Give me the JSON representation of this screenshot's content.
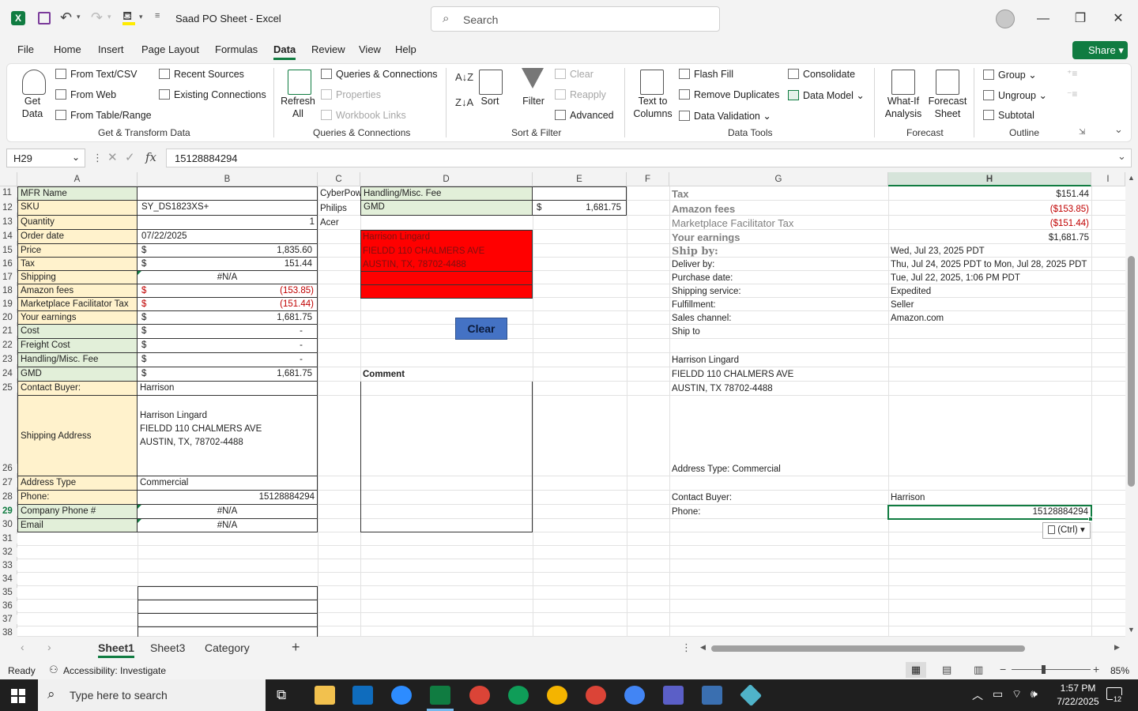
{
  "title_bar": {
    "doc_title": "Saad PO Sheet  -  Excel",
    "search_label": "Search"
  },
  "menu": [
    "File",
    "Home",
    "Insert",
    "Page Layout",
    "Formulas",
    "Data",
    "Review",
    "View",
    "Help"
  ],
  "menu_active": "Data",
  "share_label": "Share",
  "ribbon": {
    "get_data": "Get Data",
    "from_text": "From Text/CSV",
    "from_web": "From Web",
    "from_table": "From Table/Range",
    "recent_sources": "Recent Sources",
    "existing_connections": "Existing Connections",
    "group_get": "Get & Transform Data",
    "refresh_all": "Refresh All",
    "queries_connections": "Queries & Connections",
    "properties": "Properties",
    "workbook_links": "Workbook Links",
    "group_queries": "Queries & Connections",
    "sort": "Sort",
    "filter": "Filter",
    "clear": "Clear",
    "reapply": "Reapply",
    "advanced": "Advanced",
    "group_sort": "Sort & Filter",
    "text_to_columns": "Text to Columns",
    "flash_fill": "Flash Fill",
    "remove_duplicates": "Remove Duplicates",
    "data_validation": "Data Validation",
    "consolidate": "Consolidate",
    "data_model": "Data Model",
    "group_tools": "Data Tools",
    "what_if": "What-If Analysis",
    "forecast_sheet": "Forecast Sheet",
    "group_forecast": "Forecast",
    "group": "Group",
    "ungroup": "Ungroup",
    "subtotal": "Subtotal",
    "group_outline": "Outline"
  },
  "formula_bar": {
    "name_box": "H29",
    "fx": "fx",
    "value": "15128884294"
  },
  "columns": [
    "A",
    "B",
    "C",
    "D",
    "E",
    "F",
    "G",
    "H",
    "I"
  ],
  "rows": [
    "11",
    "12",
    "13",
    "14",
    "15",
    "16",
    "17",
    "18",
    "19",
    "20",
    "21",
    "22",
    "23",
    "24",
    "25",
    "26",
    "27",
    "28",
    "29",
    "30",
    "31",
    "32",
    "33",
    "34",
    "35",
    "36",
    "37",
    "38"
  ],
  "col_a": [
    "MFR Name",
    "SKU",
    "Quantity",
    "Order date",
    "Price",
    "Tax",
    "Shipping",
    "Amazon fees",
    "Marketplace Facilitator Tax",
    "Your earnings",
    "Cost",
    "Freight Cost",
    "Handling/Misc. Fee",
    "GMD",
    "Contact Buyer:",
    "Shipping Address",
    "Address Type",
    "Phone:",
    "Company Phone #",
    "Email"
  ],
  "col_b": {
    "sku": "SY_DS1823XS+",
    "qty": "1",
    "order_date": "07/22/2025",
    "dollar": "$",
    "price": "1,835.60",
    "tax": "151.44",
    "shipping": "#N/A",
    "amazon_fees": "(153.85)",
    "mft": "(151.44)",
    "earnings": "1,681.75",
    "dash": "-",
    "gmd": "1,681.75",
    "contact": "Harrison",
    "addr1": "Harrison Lingard",
    "addr2": "FIELDD 110 CHALMERS AVE",
    "addr3": "AUSTIN, TX, 78702-4488",
    "addr_type": "Commercial",
    "phone": "15128884294",
    "company_phone": "#N/A",
    "email": "#N/A"
  },
  "col_c": [
    "CyberPow",
    "Philips",
    "Acer"
  ],
  "col_d": {
    "handling": "Handling/Misc. Fee",
    "gmd": "GMD",
    "gmd_dollar": "$",
    "gmd_value": "1,681.75",
    "red1": "Harrison Lingard",
    "red2": "FIELDD 110 CHALMERS AVE",
    "red3": "AUSTIN, TX, 78702-4488",
    "clear_btn": "Clear",
    "comment": "Comment"
  },
  "col_g": {
    "tax": "Tax",
    "amazon_fees": "Amazon fees",
    "mft": "Marketplace Facilitator Tax",
    "earnings": "Your earnings",
    "ship_by": "Ship by:",
    "deliver_by": "Deliver by:",
    "purchase_date": "Purchase date:",
    "shipping_service": "Shipping service:",
    "fulfillment": "Fulfillment:",
    "sales_channel": "Sales channel:",
    "ship_to": "Ship to",
    "name": "Harrison Lingard",
    "street": "FIELDD 110 CHALMERS AVE",
    "city": "AUSTIN, TX 78702-4488",
    "address_type": "Address Type:  Commercial",
    "contact_buyer": "Contact Buyer:",
    "phone": "Phone:"
  },
  "col_h": {
    "tax": "$151.44",
    "amazon_fees": "($153.85)",
    "mft": "($151.44)",
    "earnings": "$1,681.75",
    "ship_by": "Wed, Jul 23, 2025 PDT",
    "deliver_by": "Thu, Jul 24, 2025 PDT to Mon, Jul 28, 2025 PDT",
    "purchase_date": "Tue, Jul 22, 2025, 1:06 PM PDT",
    "shipping_service": "Expedited",
    "fulfillment": "Seller",
    "sales_channel": "Amazon.com",
    "contact_buyer": "Harrison",
    "phone": "15128884294",
    "paste_ctrl": "(Ctrl)"
  },
  "sheets": [
    "Sheet1",
    "Sheet3",
    "Category"
  ],
  "active_sheet": "Sheet1",
  "status": {
    "ready": "Ready",
    "accessibility": "Accessibility: Investigate",
    "zoom": "85%"
  },
  "taskbar": {
    "search_placeholder": "Type here to search",
    "time": "1:57 PM",
    "date": "7/22/2025",
    "notif_count": "12"
  },
  "colors": {
    "accent": "#107c41",
    "red_fill": "#ff0000",
    "label_green": "#e2efd9",
    "label_yellow": "#fff2cc",
    "clear_btn": "#4472c4"
  }
}
